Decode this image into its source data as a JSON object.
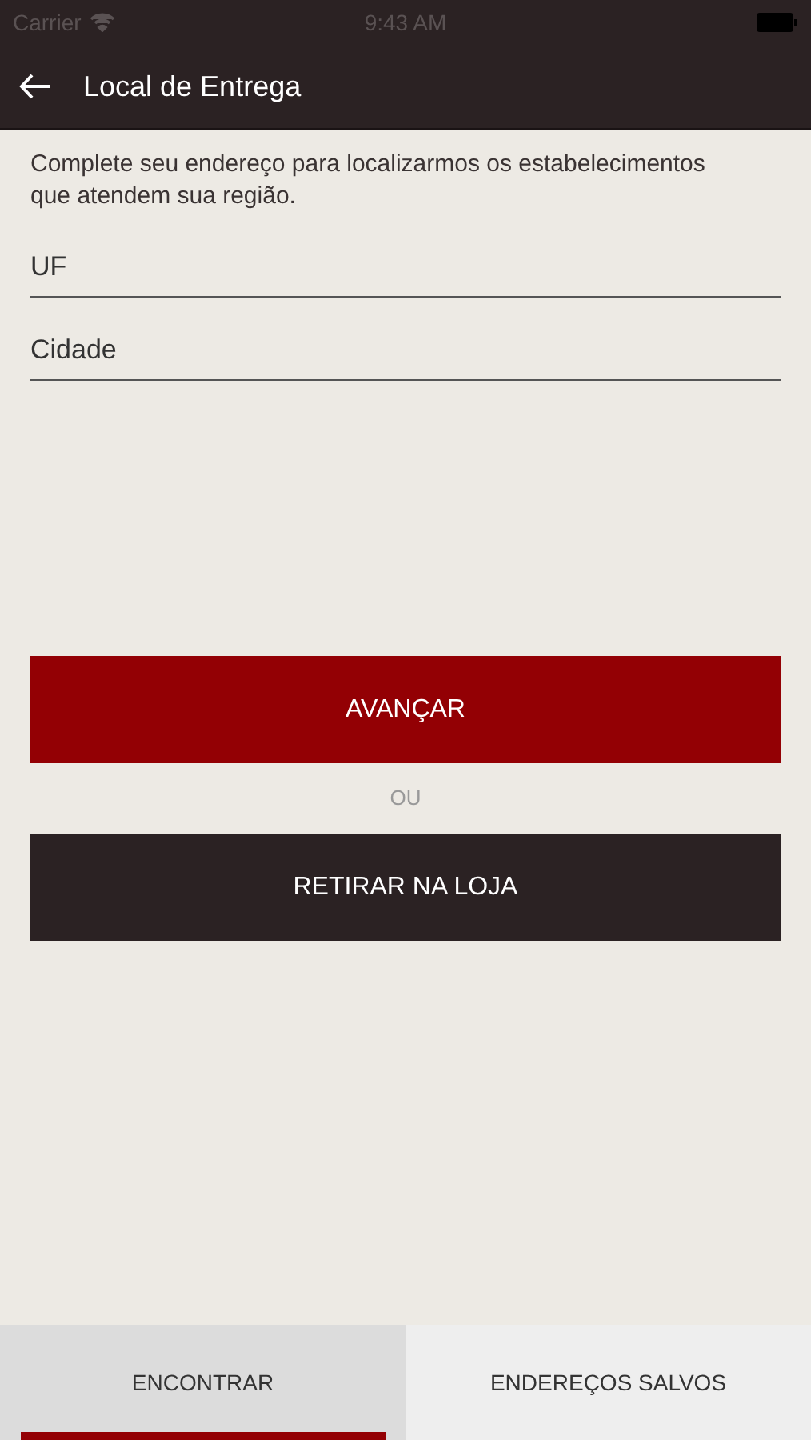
{
  "status_bar": {
    "carrier": "Carrier",
    "time": "9:43 AM"
  },
  "header": {
    "title": "Local de Entrega"
  },
  "intro": "Complete seu endereço para localizarmos os estabelecimentos que atendem sua região.",
  "fields": [
    {
      "placeholder": "UF"
    },
    {
      "placeholder": "Cidade"
    }
  ],
  "buttons": [
    {
      "label": "AVANÇAR",
      "kind": "primary"
    },
    {
      "label": "RETIRAR NA LOJA",
      "kind": "dark"
    }
  ],
  "separator": "OU",
  "tabs": [
    {
      "label": "ENCONTRAR",
      "selected": true
    },
    {
      "label": "ENDEREÇOS SALVOS",
      "selected": false
    }
  ]
}
